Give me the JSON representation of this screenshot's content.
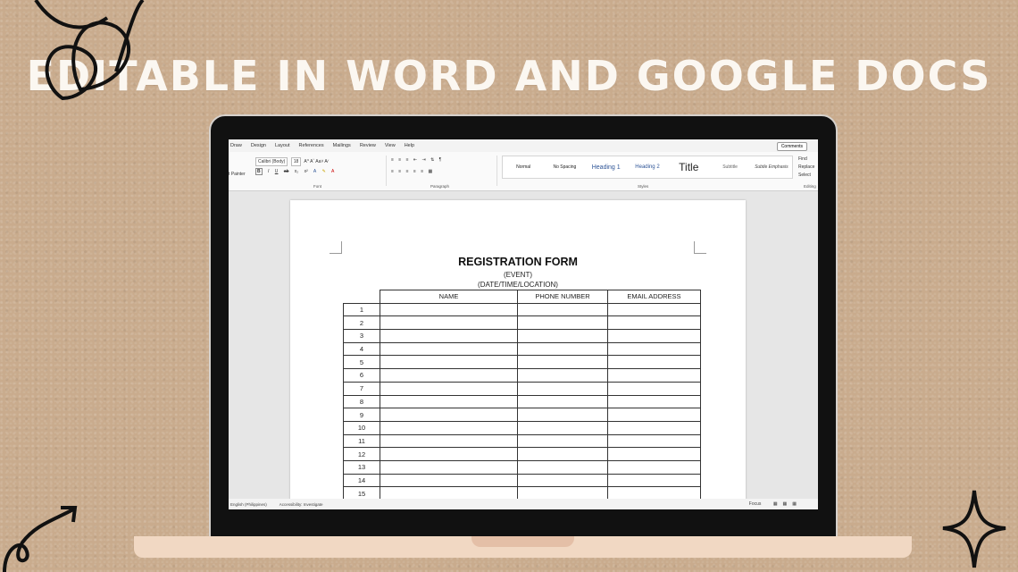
{
  "headline": "EDITABLE IN WORD AND GOOGLE DOCS",
  "ribbon": {
    "tabs": [
      "Draw",
      "Design",
      "Layout",
      "References",
      "Mailings",
      "Review",
      "View",
      "Help"
    ],
    "comments_label": "Comments",
    "font_name": "Calibri (Body)",
    "font_size": "18",
    "format_painter": "t Painter",
    "group_font": "Font",
    "group_paragraph": "Paragraph",
    "group_styles": "Styles",
    "group_editing": "Editing",
    "styles": [
      "Normal",
      "No Spacing",
      "Heading 1",
      "Heading 2",
      "Title",
      "Subtitle",
      "Subtle Emphasis"
    ],
    "editing": [
      "Find",
      "Replace",
      "Select"
    ]
  },
  "document": {
    "title": "REGISTRATION FORM",
    "line1": "(EVENT)",
    "line2": "(DATE/TIME/LOCATION)",
    "columns": [
      "NAME",
      "PHONE NUMBER",
      "EMAIL ADDRESS"
    ],
    "rows": [
      "1",
      "2",
      "3",
      "4",
      "5",
      "6",
      "7",
      "8",
      "9",
      "10",
      "11",
      "12",
      "13",
      "14",
      "15"
    ]
  },
  "status": {
    "language": "English (Philippines)",
    "accessibility": "Accessibility: Investigate",
    "focus": "Focus"
  }
}
